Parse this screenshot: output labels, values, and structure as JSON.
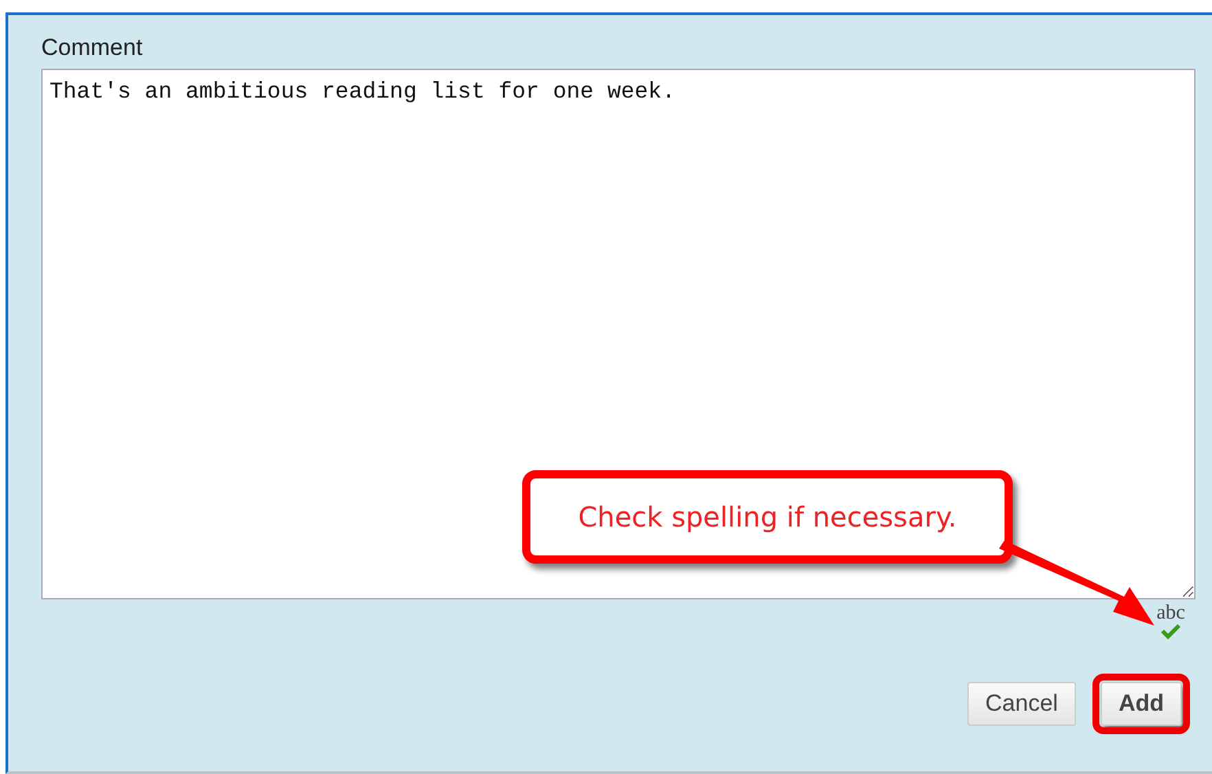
{
  "form": {
    "label": "Comment",
    "value": "That's an ambitious reading list for one week.",
    "spellcheck": "abc"
  },
  "callout": {
    "text": "Check spelling if necessary."
  },
  "buttons": [
    {
      "label": "Cancel",
      "highlighted": false
    },
    {
      "label": "Add",
      "highlighted": true
    }
  ]
}
